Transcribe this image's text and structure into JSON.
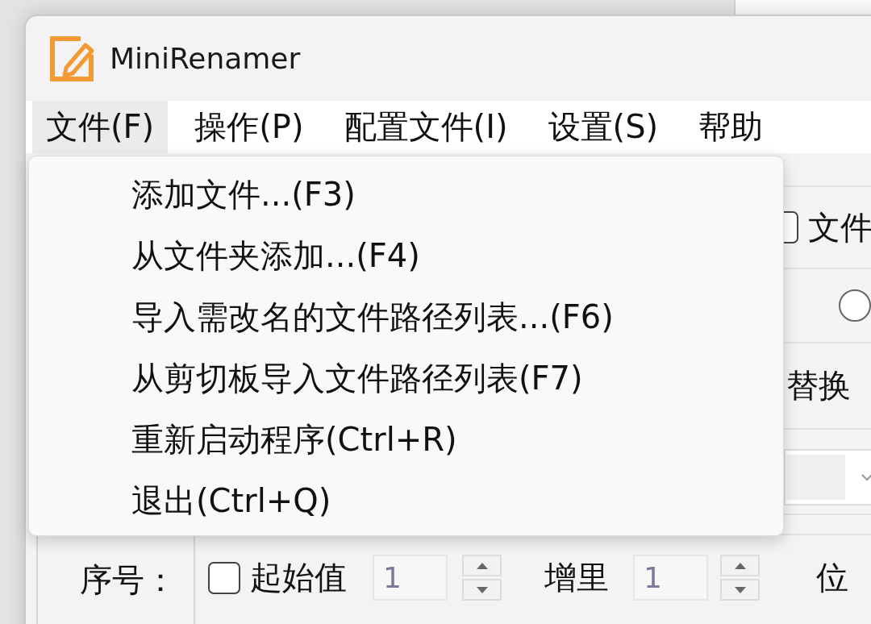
{
  "window": {
    "title": "MiniRenamer"
  },
  "menu_bar": [
    {
      "label": "文件(F)",
      "selected": true
    },
    {
      "label": "操作(P)",
      "selected": false
    },
    {
      "label": "配置文件(I)",
      "selected": false
    },
    {
      "label": "设置(S)",
      "selected": false
    },
    {
      "label": "帮助",
      "selected": false
    }
  ],
  "file_menu": [
    {
      "label": "添加文件...(F3)"
    },
    {
      "label": "从文件夹添加...(F4)"
    },
    {
      "label": "导入需改名的文件路径列表...(F6)"
    },
    {
      "label": "从剪切板导入文件路径列表(F7)"
    },
    {
      "label": "重新启动程序(Ctrl+R)"
    },
    {
      "label": "退出(Ctrl+Q)"
    }
  ],
  "options_panel": {
    "checkbox": {
      "label": "文件",
      "checked": false
    },
    "radio": {
      "selected": false
    },
    "replace_label": "替换"
  },
  "sequence": {
    "label": "序号：",
    "start": {
      "label": "起始值",
      "checked": false,
      "value": "1",
      "disabled": true
    },
    "increment": {
      "label": "增里",
      "value": "1",
      "disabled": true
    },
    "digits_label": "位"
  }
}
